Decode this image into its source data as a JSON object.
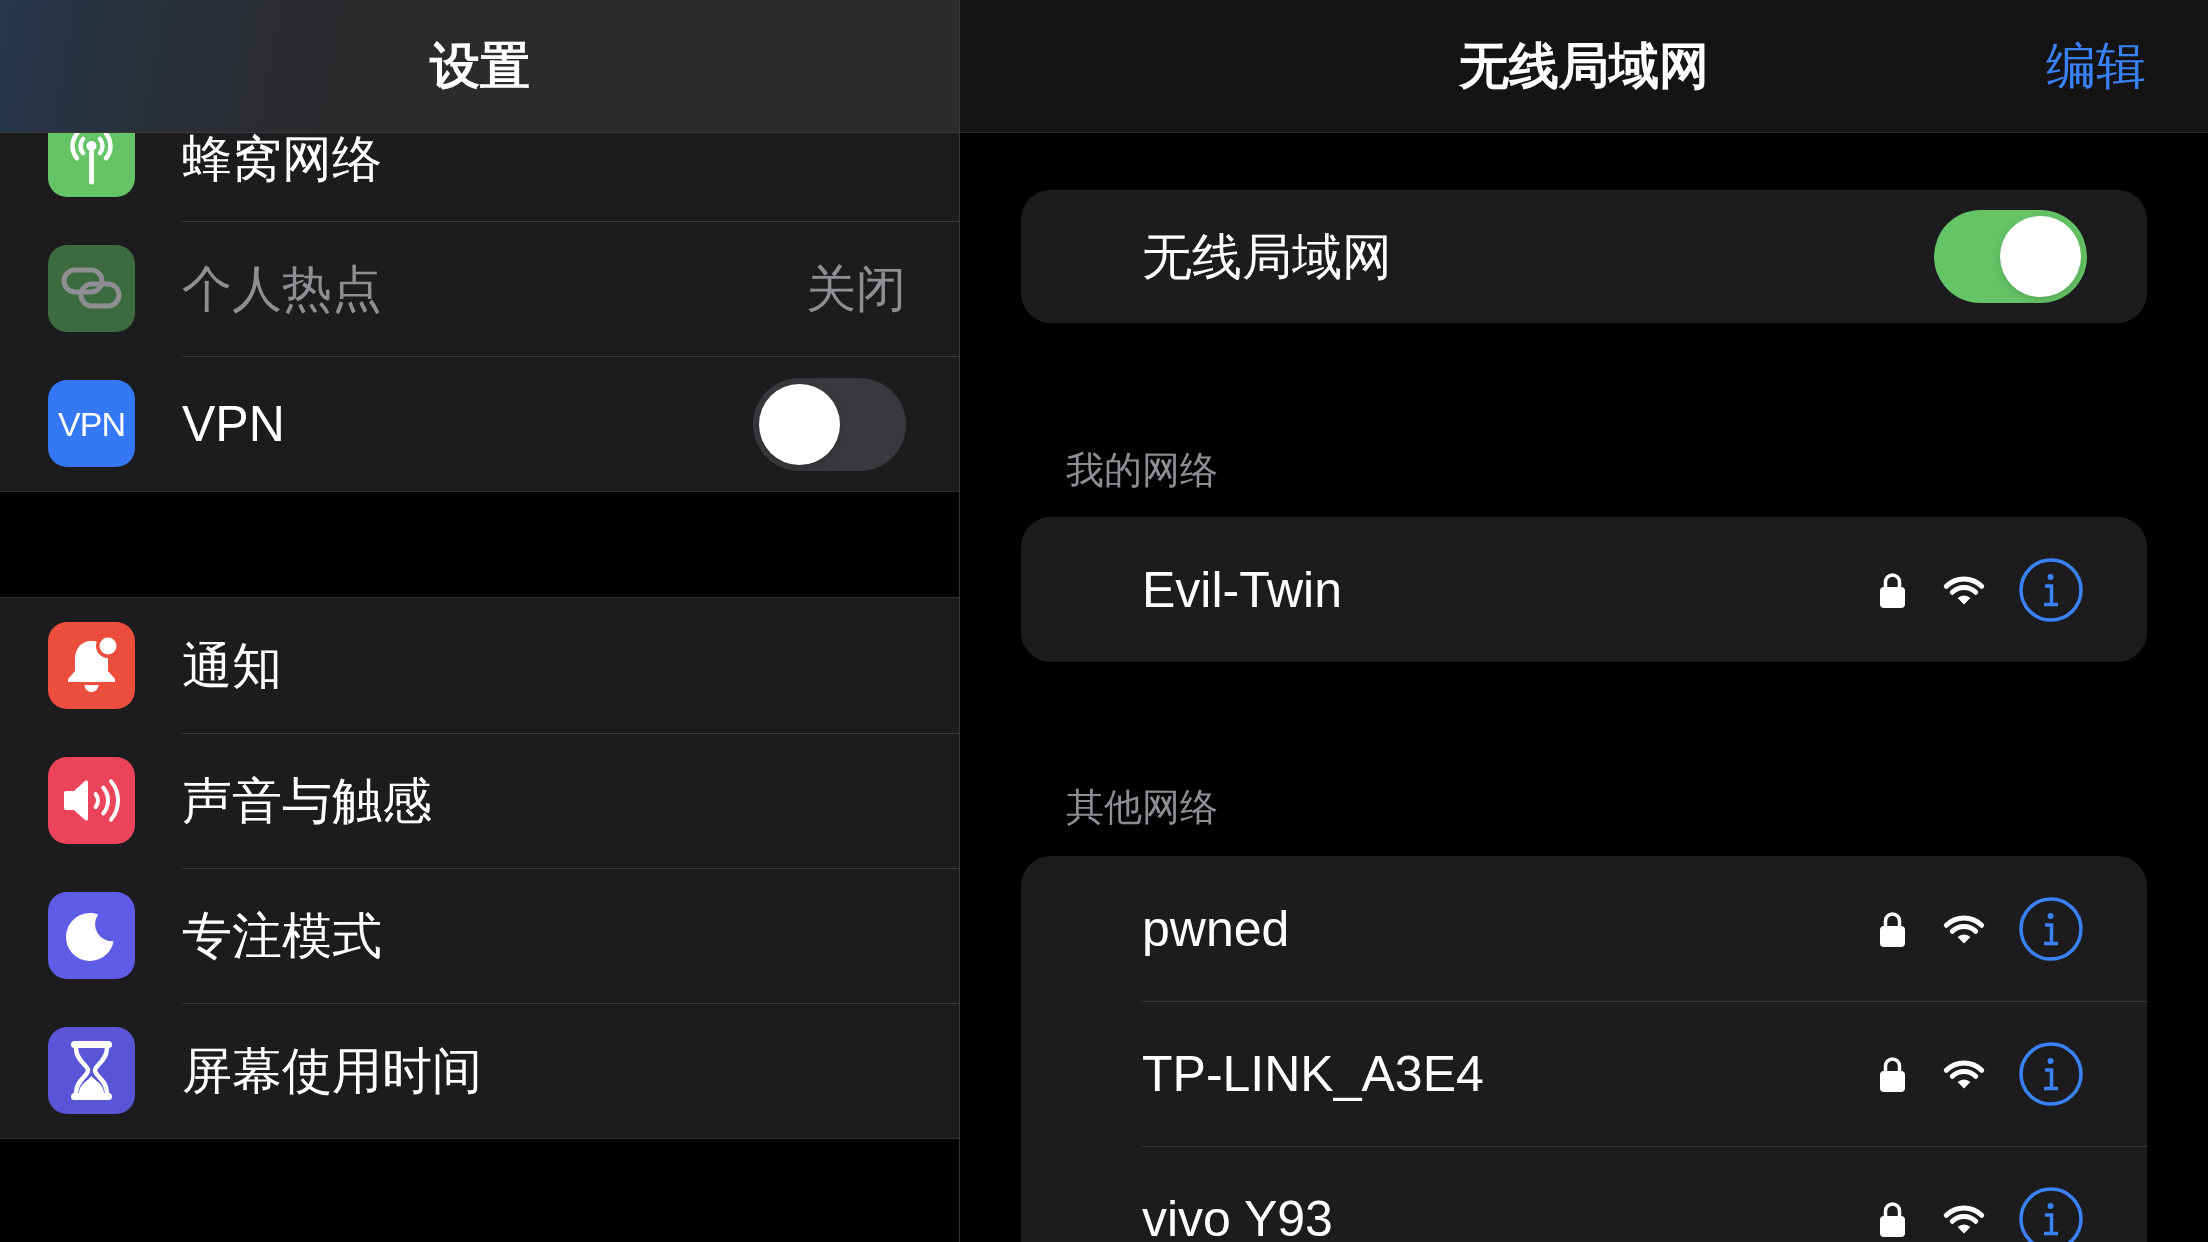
{
  "settings_panel": {
    "title": "设置",
    "groups": [
      {
        "items": [
          {
            "kind": "link",
            "label": "蜂窝网络",
            "color": "#65c466",
            "disabled": false
          },
          {
            "kind": "value",
            "label": "个人热点",
            "value": "关闭",
            "color": "#3b6b3e",
            "disabled": true
          },
          {
            "kind": "toggle",
            "label": "VPN",
            "icon_text": "VPN",
            "color": "#3478f6",
            "disabled": false,
            "on": false
          }
        ]
      },
      {
        "items": [
          {
            "kind": "link",
            "label": "通知",
            "color": "#eb4e3d",
            "disabled": false
          },
          {
            "kind": "link",
            "label": "声音与触感",
            "color": "#eb445a",
            "disabled": false
          },
          {
            "kind": "link",
            "label": "专注模式",
            "color": "#5e5ce6",
            "disabled": false
          },
          {
            "kind": "link",
            "label": "屏幕使用时间",
            "color": "#5856d6",
            "disabled": false
          }
        ]
      }
    ]
  },
  "wifi_panel": {
    "title": "无线局域网",
    "edit_button": "编辑",
    "wifi_toggle": {
      "label": "无线局域网",
      "on": true
    },
    "sections": [
      {
        "header": "我的网络",
        "networks": [
          {
            "name": "Evil-Twin",
            "locked": true
          }
        ]
      },
      {
        "header": "其他网络",
        "networks": [
          {
            "name": "pwned",
            "locked": true
          },
          {
            "name": "TP-LINK_A3E4",
            "locked": true
          },
          {
            "name": "vivo Y93",
            "locked": true
          }
        ]
      }
    ]
  }
}
